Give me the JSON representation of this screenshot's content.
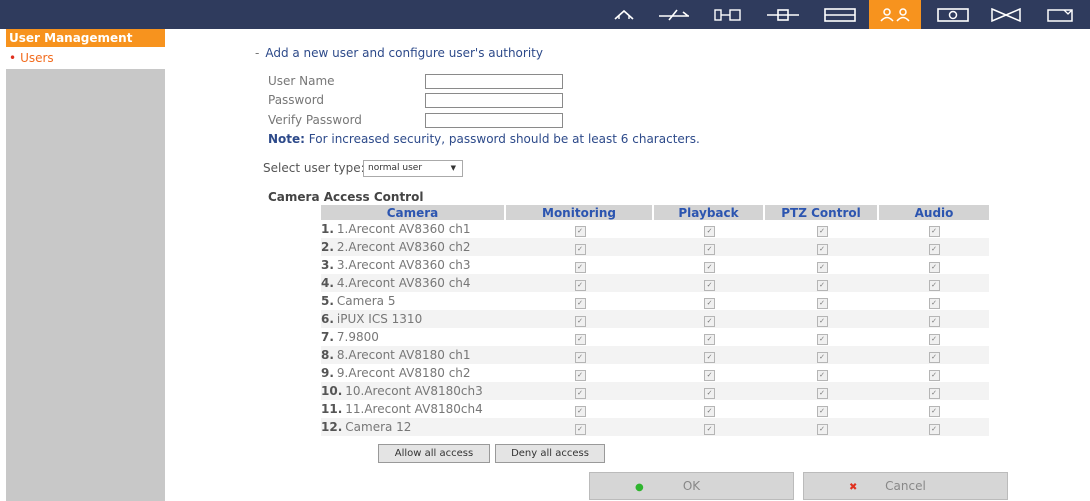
{
  "topbar": {
    "icons": [
      {
        "name": "home-icon",
        "active": false
      },
      {
        "name": "network-icon",
        "active": false
      },
      {
        "name": "device-settings-icon",
        "active": false
      },
      {
        "name": "connection-icon",
        "active": false
      },
      {
        "name": "display-icon",
        "active": false
      },
      {
        "name": "users-icon",
        "active": true
      },
      {
        "name": "camera-icon",
        "active": false
      },
      {
        "name": "playback-icon",
        "active": false
      },
      {
        "name": "folder-icon",
        "active": false
      }
    ],
    "colors": {
      "bar": "#2f3b5d",
      "accent": "#f7931e"
    }
  },
  "sidebar": {
    "header": "User Management",
    "items": [
      {
        "label": "Users"
      }
    ]
  },
  "form": {
    "title": "Add a new user and configure user's authority",
    "title_prefix": "-",
    "username_label": "User Name",
    "password_label": "Password",
    "verify_label": "Verify Password",
    "username_value": "",
    "password_value": "",
    "verify_value": "",
    "note_label": "Note:",
    "note_text": "For increased security, password should be at least 6 characters.",
    "user_type_label": "Select user type:",
    "user_type_value": "normal user"
  },
  "access": {
    "title": "Camera Access Control",
    "columns": [
      "Camera",
      "Monitoring",
      "Playback",
      "PTZ Control",
      "Audio"
    ],
    "rows": [
      {
        "num": "1.",
        "name": "1.Arecont AV8360 ch1"
      },
      {
        "num": "2.",
        "name": "2.Arecont AV8360 ch2"
      },
      {
        "num": "3.",
        "name": "3.Arecont AV8360 ch3"
      },
      {
        "num": "4.",
        "name": "4.Arecont AV8360 ch4"
      },
      {
        "num": "5.",
        "name": "Camera 5"
      },
      {
        "num": "6.",
        "name": "iPUX ICS 1310"
      },
      {
        "num": "7.",
        "name": "7.9800"
      },
      {
        "num": "8.",
        "name": "8.Arecont AV8180 ch1"
      },
      {
        "num": "9.",
        "name": "9.Arecont AV8180 ch2"
      },
      {
        "num": "10.",
        "name": "10.Arecont AV8180ch3"
      },
      {
        "num": "11.",
        "name": "11.Arecont AV8180ch4"
      },
      {
        "num": "12.",
        "name": "Camera 12"
      }
    ],
    "allow_label": "Allow all access",
    "deny_label": "Deny all access"
  },
  "actions": {
    "ok_label": "OK",
    "ok_marker": "●",
    "ok_color": "#2fb52f",
    "cancel_label": "Cancel",
    "cancel_marker": "✖",
    "cancel_color": "#e0301e"
  }
}
